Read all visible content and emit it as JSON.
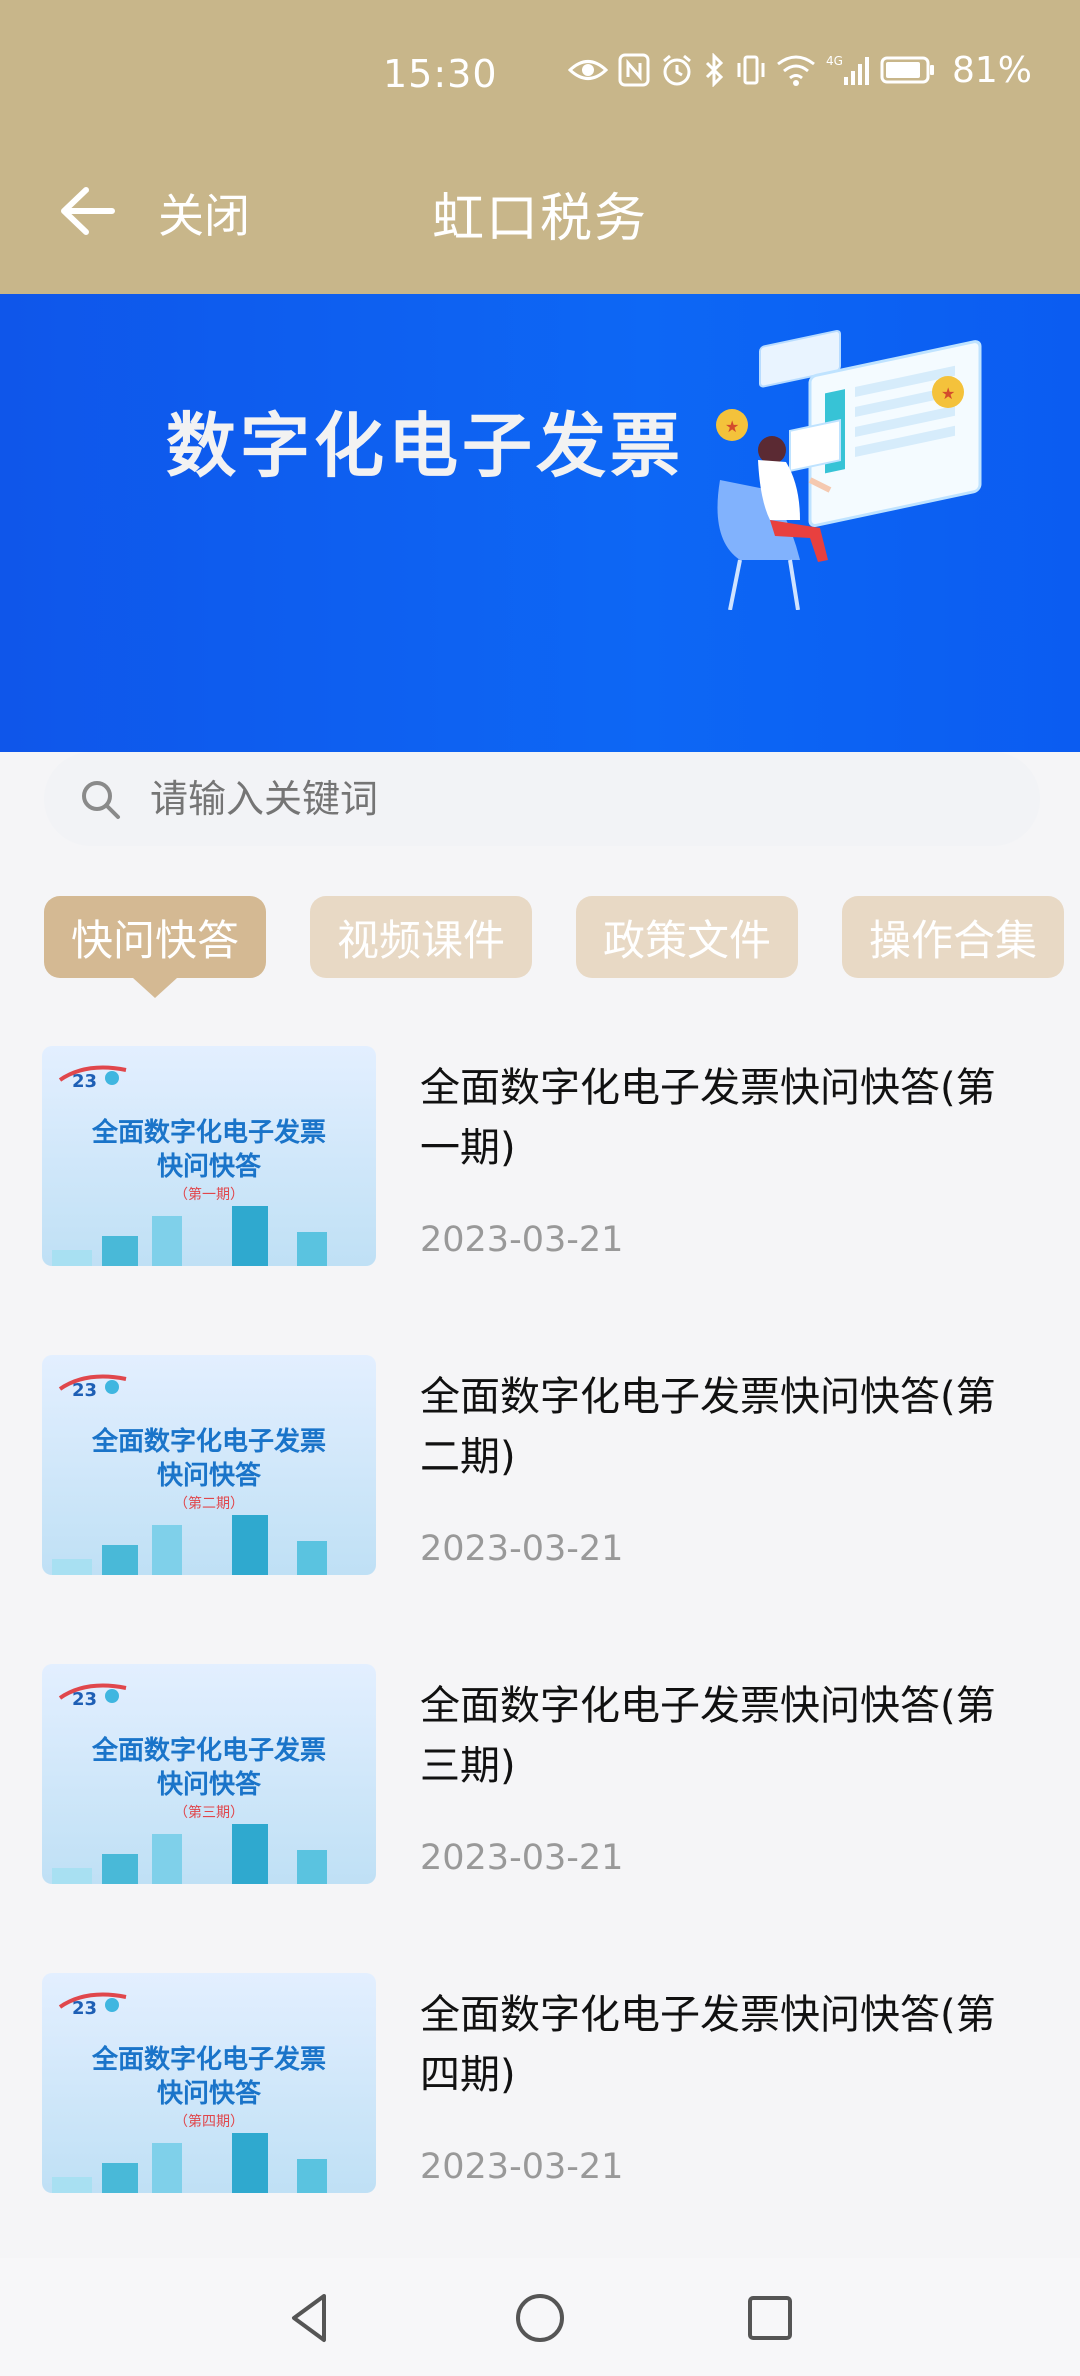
{
  "status_bar": {
    "time": "15:30",
    "battery_percent": "81%",
    "icons": [
      "eye-icon",
      "nfc-icon",
      "alarm-icon",
      "bluetooth-icon",
      "vibrate-icon",
      "wifi-icon",
      "signal-4g-icon",
      "battery-icon"
    ]
  },
  "header": {
    "back_icon": "arrow-left-icon",
    "close_label": "关闭",
    "title": "虹口税务"
  },
  "banner": {
    "title": "数字化电子发票"
  },
  "search": {
    "placeholder": "请输入关键词"
  },
  "tabs": [
    {
      "label": "快问快答",
      "active": true
    },
    {
      "label": "视频课件",
      "active": false
    },
    {
      "label": "政策文件",
      "active": false
    },
    {
      "label": "操作合集",
      "active": false
    }
  ],
  "articles": [
    {
      "title": "全面数字化电子发票快问快答(第一期)",
      "date": "2023-03-21",
      "thumb_title": "全面数字化电子发票",
      "thumb_sub": "快问快答",
      "thumb_issue": "（第一期）"
    },
    {
      "title": "全面数字化电子发票快问快答(第二期)",
      "date": "2023-03-21",
      "thumb_title": "全面数字化电子发票",
      "thumb_sub": "快问快答",
      "thumb_issue": "（第二期）"
    },
    {
      "title": "全面数字化电子发票快问快答(第三期)",
      "date": "2023-03-21",
      "thumb_title": "全面数字化电子发票",
      "thumb_sub": "快问快答",
      "thumb_issue": "（第三期）"
    },
    {
      "title": "全面数字化电子发票快问快答(第四期)",
      "date": "2023-03-21",
      "thumb_title": "全面数字化电子发票",
      "thumb_sub": "快问快答",
      "thumb_issue": "（第四期）"
    }
  ],
  "navbar": {
    "buttons": [
      "back-triangle-icon",
      "home-circle-icon",
      "recents-square-icon"
    ]
  },
  "colors": {
    "header_bg": "#c8b68a",
    "banner_bg": "#0d67f5",
    "tab_active": "#d4b993",
    "tab_inactive": "#e8d9c5"
  }
}
